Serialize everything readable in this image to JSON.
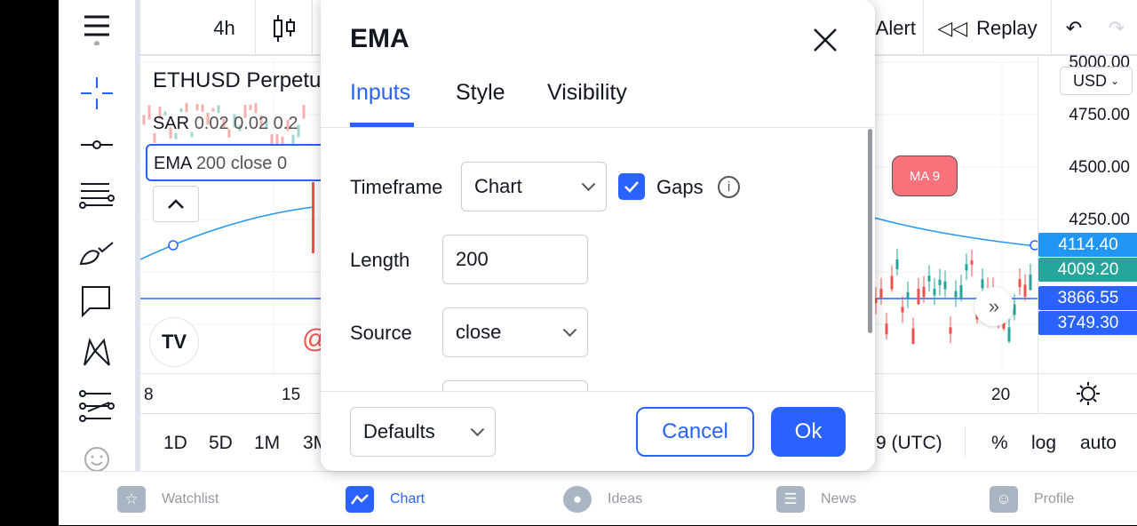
{
  "toolbar": {
    "interval": "4h",
    "alert": "Alert",
    "replay": "Replay"
  },
  "chart": {
    "symbol": "ETHUSD Perpetu",
    "sar_name": "SAR",
    "sar_params": "0.02 0.02 0.2",
    "ema_name": "EMA",
    "ema_params": "200 close 0",
    "ma_label": "MA 9",
    "at_sign": "@"
  },
  "price_axis": {
    "currency": "USD",
    "labels": [
      "5000.00",
      "4750.00",
      "4500.00",
      "4250.00"
    ],
    "badges": [
      {
        "value": "4114.40",
        "color": "#2196f3"
      },
      {
        "value": "4009.20",
        "color": "#26a69a"
      },
      {
        "value": "3866.55",
        "color": "#2962ff"
      },
      {
        "value": "3749.30",
        "color": "#2962ff"
      }
    ]
  },
  "time_axis": {
    "labels": [
      "8",
      "15",
      "20"
    ]
  },
  "range_bar": {
    "ranges": [
      "1D",
      "5D",
      "1M",
      "3M"
    ],
    "timezone": "9 (UTC)",
    "percent": "%",
    "log": "log",
    "auto": "auto"
  },
  "bottom_nav": [
    {
      "label": "Watchlist",
      "icon": "star-icon",
      "active": false
    },
    {
      "label": "Chart",
      "icon": "chart-icon",
      "active": true
    },
    {
      "label": "Ideas",
      "icon": "lightbulb-icon",
      "active": false
    },
    {
      "label": "News",
      "icon": "news-icon",
      "active": false
    },
    {
      "label": "Profile",
      "icon": "smiley-icon",
      "active": false
    }
  ],
  "dialog": {
    "title": "EMA",
    "tabs": [
      "Inputs",
      "Style",
      "Visibility"
    ],
    "active_tab": "Inputs",
    "timeframe_label": "Timeframe",
    "timeframe_value": "Chart",
    "gaps_label": "Gaps",
    "gaps_checked": true,
    "length_label": "Length",
    "length_value": "200",
    "source_label": "Source",
    "source_value": "close",
    "defaults": "Defaults",
    "cancel": "Cancel",
    "ok": "Ok"
  },
  "colors": {
    "accent": "#2962ff",
    "up": "#26a69a",
    "down": "#ef5350",
    "ema": "#2196f3"
  }
}
